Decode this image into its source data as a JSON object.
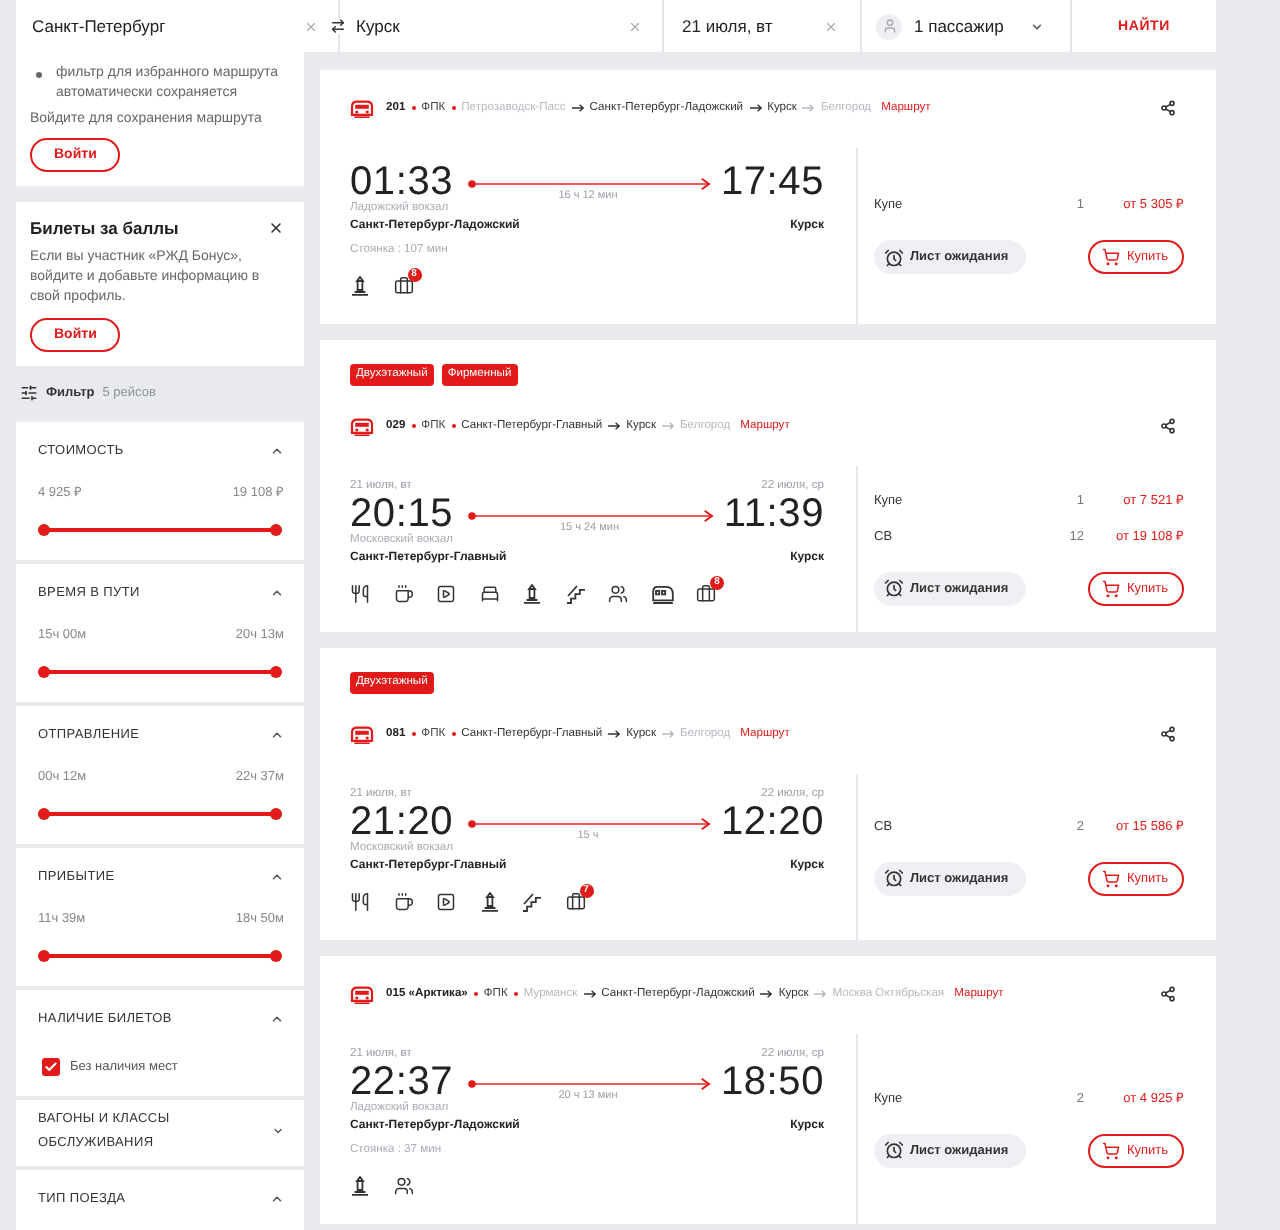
{
  "search_bar": {
    "from": "Санкт-Петербург",
    "to": "Курск",
    "date": "21 июля, вт",
    "passengers": "1 пассажир",
    "submit": "НАЙТИ"
  },
  "sidebar": {
    "route_notice": {
      "bullets": [
        "фильтр для избранного маршрута автоматически сохраняется"
      ],
      "text": "Войдите для сохранения маршрута",
      "button": "Войти"
    },
    "bonus_card": {
      "title": "Билеты за баллы",
      "text": "Если вы участник «РЖД Бонус», войдите и добавьте информацию в свой профиль.",
      "button": "Войти"
    },
    "filter": {
      "label": "Фильтр",
      "count": "5 рейсов"
    },
    "filter_sections": [
      {
        "kind": "range",
        "title": "СТОИМОСТЬ",
        "expanded": true,
        "min": "4 925 ₽",
        "max": "19 108 ₽",
        "level": 1
      },
      {
        "kind": "range",
        "title": "ВРЕМЯ В ПУТИ",
        "expanded": true,
        "min": "15ч 00м",
        "max": "20ч 13м",
        "level": 1
      },
      {
        "kind": "range",
        "title": "ОТПРАВЛЕНИЕ",
        "expanded": true,
        "min": "00ч 12м",
        "max": "22ч 37м",
        "level": 1
      },
      {
        "kind": "range",
        "title": "ПРИБЫТИЕ",
        "expanded": true,
        "min": "11ч 39м",
        "max": "18ч 50м",
        "level": 1
      },
      {
        "kind": "checkbox",
        "title": "НАЛИЧИЕ БИЛЕТОВ",
        "expanded": true,
        "options": [
          {
            "label": "Без наличия мест",
            "checked": true
          }
        ]
      },
      {
        "kind": "header",
        "title": "ВАГОНЫ И КЛАССЫ ОБСЛУЖИВАНИЯ",
        "expanded": false
      },
      {
        "kind": "header",
        "title": "ТИП ПОЕЗДА",
        "expanded": true
      }
    ]
  },
  "trains": [
    {
      "number": "201",
      "carrier": "ФПК",
      "route": [
        {
          "name": "Петрозаводск-Пасс",
          "in_trip": false
        },
        {
          "name": "Санкт-Петербург-Ладожский",
          "in_trip": true
        },
        {
          "name": "Курск",
          "in_trip": true
        },
        {
          "name": "Белгород",
          "in_trip": false
        }
      ],
      "route_link": "Маршрут",
      "departure": {
        "time": "01:33",
        "station": "Ладожский вокзал",
        "city": "Санкт-Петербург-Ладожский"
      },
      "arrival": {
        "time": "17:45",
        "city": "Курск"
      },
      "duration": "16 ч 12 мин",
      "stop": "Стоянка : 107 мин",
      "amenities": [
        {
          "kind": "monument"
        },
        {
          "kind": "baggage",
          "badge": "8"
        }
      ],
      "fares": [
        {
          "class": "Купе",
          "seats": "1",
          "price": "от 5 305 ₽"
        }
      ],
      "waitlist": "Лист ожидания",
      "buy": "Купить"
    },
    {
      "tags": [
        "Двухэтажный",
        "Фирменный"
      ],
      "number": "029",
      "carrier": "ФПК",
      "route": [
        {
          "name": "Санкт-Петербург-Главный",
          "in_trip": true
        },
        {
          "name": "Курск",
          "in_trip": true
        },
        {
          "name": "Белгород",
          "in_trip": false
        }
      ],
      "route_link": "Маршрут",
      "departure": {
        "date": "21 июля, вт",
        "time": "20:15",
        "station": "Московский вокзал",
        "city": "Санкт-Петербург-Главный"
      },
      "arrival": {
        "date": "22 июля, ср",
        "time": "11:39",
        "city": "Курск"
      },
      "duration": "15 ч 24 мин",
      "amenities": [
        {
          "kind": "dining"
        },
        {
          "kind": "cup"
        },
        {
          "kind": "media"
        },
        {
          "kind": "bed"
        },
        {
          "kind": "monument"
        },
        {
          "kind": "stairs"
        },
        {
          "kind": "people"
        },
        {
          "kind": "wagon"
        },
        {
          "kind": "baggage",
          "badge": "8"
        }
      ],
      "fares": [
        {
          "class": "Купе",
          "seats": "1",
          "price": "от 7 521 ₽"
        },
        {
          "class": "СВ",
          "seats": "12",
          "price": "от 19 108 ₽"
        }
      ],
      "waitlist": "Лист ожидания",
      "buy": "Купить"
    },
    {
      "tags": [
        "Двухэтажный"
      ],
      "number": "081",
      "carrier": "ФПК",
      "route": [
        {
          "name": "Санкт-Петербург-Главный",
          "in_trip": true
        },
        {
          "name": "Курск",
          "in_trip": true
        },
        {
          "name": "Белгород",
          "in_trip": false
        }
      ],
      "route_link": "Маршрут",
      "departure": {
        "date": "21 июля, вт",
        "time": "21:20",
        "station": "Московский вокзал",
        "city": "Санкт-Петербург-Главный"
      },
      "arrival": {
        "date": "22 июля, ср",
        "time": "12:20",
        "city": "Курск"
      },
      "duration": "15 ч",
      "amenities": [
        {
          "kind": "dining"
        },
        {
          "kind": "cup"
        },
        {
          "kind": "media"
        },
        {
          "kind": "monument"
        },
        {
          "kind": "stairs"
        },
        {
          "kind": "baggage",
          "badge": "7"
        }
      ],
      "fares": [
        {
          "class": "СВ",
          "seats": "2",
          "price": "от 15 586 ₽"
        }
      ],
      "waitlist": "Лист ожидания",
      "buy": "Купить"
    },
    {
      "number": "015 «Арктика»",
      "carrier": "ФПК",
      "route": [
        {
          "name": "Мурманск",
          "in_trip": false
        },
        {
          "name": "Санкт-Петербург-Ладожский",
          "in_trip": true
        },
        {
          "name": "Курск",
          "in_trip": true
        },
        {
          "name": "Москва Октябрьская",
          "in_trip": false
        }
      ],
      "route_link": "Маршрут",
      "departure": {
        "date": "21 июля, вт",
        "time": "22:37",
        "station": "Ладожский вокзал",
        "city": "Санкт-Петербург-Ладожский"
      },
      "arrival": {
        "date": "22 июля, ср",
        "time": "18:50",
        "city": "Курск"
      },
      "duration": "20 ч 13 мин",
      "stop": "Стоянка : 37 мин",
      "amenities": [
        {
          "kind": "monument"
        },
        {
          "kind": "people"
        }
      ],
      "fares": [
        {
          "class": "Купе",
          "seats": "2",
          "price": "от 4 925 ₽"
        }
      ],
      "waitlist": "Лист ожидания",
      "buy": "Купить"
    }
  ]
}
